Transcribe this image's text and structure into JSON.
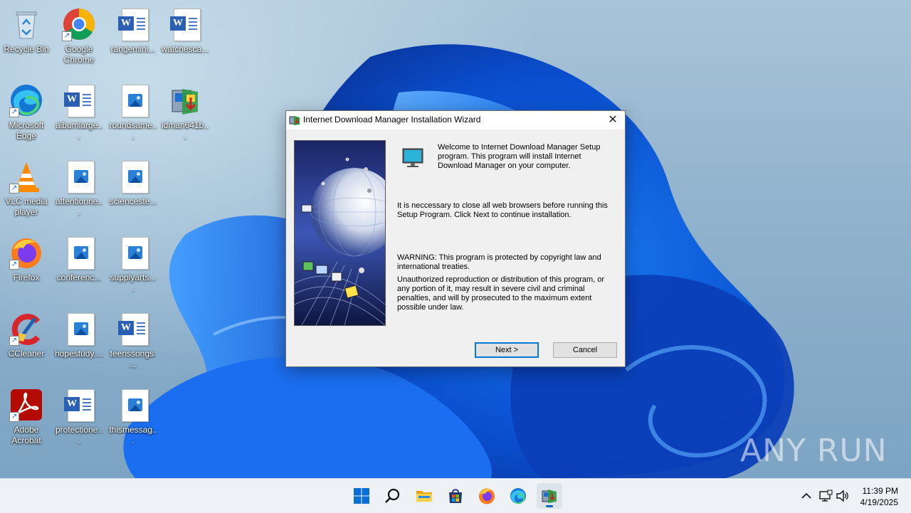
{
  "desktop": {
    "icons": [
      {
        "label": "Recycle Bin",
        "icon": "recycle-bin-icon"
      },
      {
        "label": "Google Chrome",
        "icon": "chrome-icon"
      },
      {
        "label": "rangemini...",
        "icon": "word-document-icon"
      },
      {
        "label": "watchesca...",
        "icon": "word-document-icon"
      },
      {
        "label": "Microsoft Edge",
        "icon": "edge-icon"
      },
      {
        "label": "albumlarge...",
        "icon": "word-document-icon"
      },
      {
        "label": "roundsame...",
        "icon": "image-file-icon"
      },
      {
        "label": "idman641b...",
        "icon": "idm-installer-icon"
      },
      {
        "label": "VLC media player",
        "icon": "vlc-icon"
      },
      {
        "label": "attentionne...",
        "icon": "image-file-icon"
      },
      {
        "label": "scienceste...",
        "icon": "image-file-icon"
      },
      {
        "label": "Firefox",
        "icon": "firefox-icon"
      },
      {
        "label": "conferenc...",
        "icon": "image-file-icon"
      },
      {
        "label": "supplyarts....",
        "icon": "image-file-icon"
      },
      {
        "label": "CCleaner",
        "icon": "ccleaner-icon"
      },
      {
        "label": "hopestudy....",
        "icon": "image-file-icon"
      },
      {
        "label": "teenssongs....",
        "icon": "word-document-icon"
      },
      {
        "label": "Adobe Acrobat",
        "icon": "acrobat-icon"
      },
      {
        "label": "protectione...",
        "icon": "word-document-icon"
      },
      {
        "label": "thismessag...",
        "icon": "image-file-icon"
      }
    ]
  },
  "dialog": {
    "title": "Internet Download Manager Installation Wizard",
    "welcome": "Welcome to Internet Download Manager Setup program. This program will install Internet Download Manager on your computer.",
    "close_browsers": "It is neccessary to close all web browsers before running this Setup Program. Click Next to continue installation.",
    "warning": "WARNING: This program is protected by copyright law and international treaties.",
    "unauthorized": "Unauthorized reproduction or distribution of this program, or any portion of it, may result in severe civil and criminal penalties, and will by prosecuted to the maximum extent possible under law.",
    "next_label": "Next >",
    "cancel_label": "Cancel"
  },
  "taskbar": {
    "items": [
      "start-icon",
      "search-icon",
      "file-explorer-icon",
      "microsoft-store-icon",
      "firefox-icon",
      "edge-icon",
      "idm-setup-icon"
    ],
    "time": "11:39 PM",
    "date": "4/19/2025"
  },
  "watermark": {
    "text": "ANY RUN"
  },
  "colors": {
    "accent": "#0078d7",
    "taskbar": "#eef1f5",
    "dialog_bg": "#f0f0f0"
  }
}
